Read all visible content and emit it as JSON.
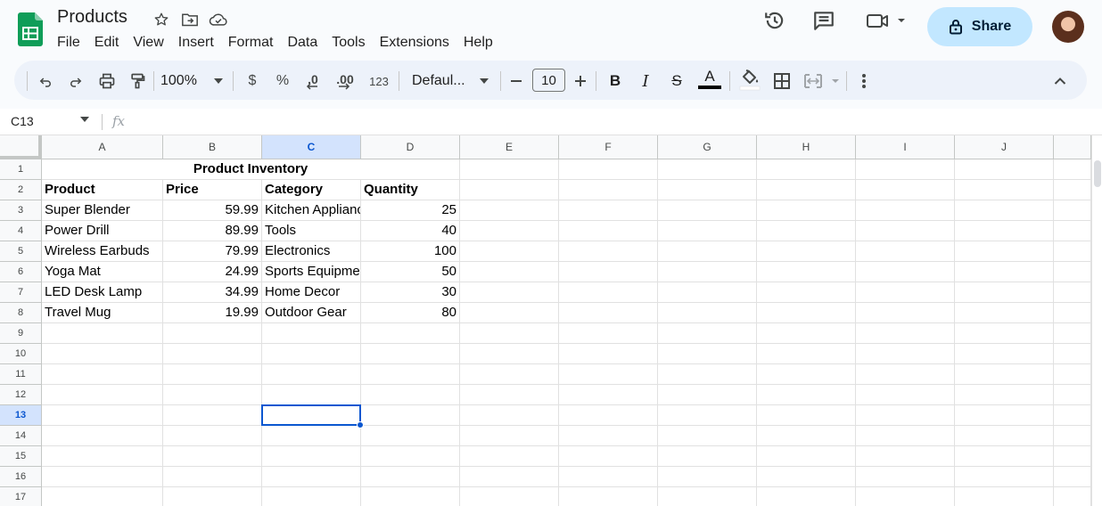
{
  "doc": {
    "title": "Products"
  },
  "menu": [
    "File",
    "Edit",
    "View",
    "Insert",
    "Format",
    "Data",
    "Tools",
    "Extensions",
    "Help"
  ],
  "share": {
    "label": "Share"
  },
  "toolbar": {
    "zoom": "100%",
    "currency": "$",
    "percent": "%",
    "dec_decrease": ".0",
    "dec_increase": ".00",
    "more_formats": "123",
    "font": "Defaul...",
    "font_size": "10",
    "bold": "B",
    "italic": "I",
    "strike": "S",
    "text_color": "A"
  },
  "formula_bar": {
    "cell_ref": "C13",
    "fx": "fx",
    "value": ""
  },
  "columns": [
    "A",
    "B",
    "C",
    "D",
    "E",
    "F",
    "G",
    "H",
    "I",
    "J"
  ],
  "rows": [
    "1",
    "2",
    "3",
    "4",
    "5",
    "6",
    "7",
    "8",
    "9",
    "10",
    "11",
    "12",
    "13",
    "14",
    "15",
    "16",
    "17"
  ],
  "sheet": {
    "title": "Product Inventory",
    "headers": [
      "Product",
      "Price",
      "Category",
      "Quantity"
    ],
    "records": [
      [
        "Super Blender",
        "59.99",
        "Kitchen Appliances",
        "25"
      ],
      [
        "Power Drill",
        "89.99",
        "Tools",
        "40"
      ],
      [
        "Wireless Earbuds",
        "79.99",
        "Electronics",
        "100"
      ],
      [
        "Yoga Mat",
        "24.99",
        "Sports Equipment",
        "50"
      ],
      [
        "LED Desk Lamp",
        "34.99",
        "Home Decor",
        "30"
      ],
      [
        "Travel Mug",
        "19.99",
        "Outdoor Gear",
        "80"
      ]
    ]
  },
  "selection": {
    "cell": "C13",
    "column": "C",
    "row": "13"
  },
  "colors": {
    "accent": "#0b57d0",
    "share_bg": "#c2e7ff",
    "sheets_green": "#0f9d58",
    "toolbar_bg": "#edf2fa"
  }
}
